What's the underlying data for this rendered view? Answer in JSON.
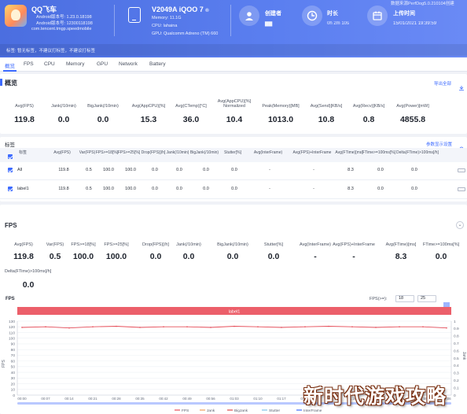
{
  "header": {
    "app": {
      "name": "QQ飞车",
      "lines": [
        "Android版本号: 1.23.0.18198",
        "Android版本号: 12300118198"
      ],
      "package": "com.tencent.tmgp.speedmobile"
    },
    "device": {
      "name": "V2049A iQOO 7",
      "badge": "®",
      "lines": [
        "Memory: 11.1G",
        "CPU: lahaina",
        "GPU: Qualcomm Adreno (TM) 660"
      ]
    },
    "creator": {
      "label": "创建者",
      "value": "▇▇"
    },
    "duration": {
      "label": "时长",
      "value": "0h 2m 10s"
    },
    "upload": {
      "label": "上传时间",
      "value": "15/01/2021 19:39:59",
      "top_text": "数据来源PerfDog5.0.210104创建"
    },
    "tags_text": "标签: 暂无标签，不建议打标签，不建议打标签"
  },
  "tabs": [
    "概览",
    "FPS",
    "CPU",
    "Memory",
    "GPU",
    "Network",
    "Battery"
  ],
  "overview": {
    "title": "概览",
    "export_link": "导出全部",
    "labels": [
      "Avg(FPS)",
      "Jank(/10min)",
      "BigJank(/10min)",
      "Avg(AppCPU)[%]",
      "Avg(CTemp)[°C]",
      "Avg(AppCPU)[%] Normalized",
      "Peak(Memory)[MB]",
      "Avg(Send)[KB/s]",
      "Avg(Recv)[KB/s]",
      "Avg(Power)[mW]"
    ],
    "values": [
      "119.8",
      "0.0",
      "0.0",
      "15.3",
      "36.0",
      "10.4",
      "1013.0",
      "10.8",
      "0.8",
      "4855.8"
    ]
  },
  "label_table": {
    "title": "标签",
    "right_link": "参数显示设置",
    "headers": [
      "标签",
      "Avg(FPS)",
      "Var(FPS)",
      "FPS>=18[%]",
      "FPS>=25[%]",
      "Drop(FPS)[/h]",
      "Jank(/10min)",
      "BigJank(/10min)",
      "Stutter[%]",
      "Avg(InterFrame)",
      "Avg(FPS)+InterFrame",
      "Avg(FTime)[ms]",
      "FTime>=100ms[%]",
      "Delta(FTime)>100ms[/h]"
    ],
    "rows": [
      {
        "name": "All",
        "values": [
          "119.8",
          "0.5",
          "100.0",
          "100.0",
          "0.0",
          "0.0",
          "0.0",
          "0.0",
          "-",
          "-",
          "8.3",
          "0.0",
          "0.0"
        ]
      },
      {
        "name": "label1",
        "values": [
          "119.8",
          "0.5",
          "100.0",
          "100.0",
          "0.0",
          "0.0",
          "0.0",
          "0.0",
          "-",
          "-",
          "8.3",
          "0.0",
          "0.0"
        ]
      }
    ]
  },
  "fps_section": {
    "title": "FPS",
    "labels": [
      "Avg(FPS)",
      "Var(FPS)",
      "FPS>=18[%]",
      "FPS>=25[%]",
      "Drop(FPS)[/h]",
      "Jank(/10min)",
      "BigJank(/10min)",
      "Stutter[%]",
      "Avg(InterFrame)",
      "Avg(FPS)+InterFrame",
      "Avg(FTime)[ms]",
      "FTime>=100ms[%]"
    ],
    "values": [
      "119.8",
      "0.5",
      "100.0",
      "100.0",
      "0.0",
      "0.0",
      "0.0",
      "0.0",
      "-",
      "-",
      "8.3",
      "0.0"
    ],
    "extra_label": "Delta(FTime)>100ms[/h]",
    "extra_value": "0.0"
  },
  "fps_chart": {
    "label": "FPS",
    "filter_label": "FPS(>=):",
    "filter_values": [
      "18",
      "25"
    ],
    "band_label": "label1",
    "y_axis_title": "FPS",
    "right_axis_title": "Jank",
    "watermark": "新时代游戏攻略"
  },
  "chart_data": {
    "type": "line",
    "x": [
      "00:00",
      "00:07",
      "00:14",
      "00:21",
      "00:28",
      "00:35",
      "00:42",
      "00:49",
      "00:56",
      "01:03",
      "01:10",
      "01:17",
      "01:24",
      "01:31",
      "01:38",
      "01:45",
      "01:52",
      "01:59",
      "02:06"
    ],
    "ylim": [
      0,
      130
    ],
    "yticks": [
      0,
      10,
      20,
      30,
      40,
      50,
      60,
      70,
      80,
      90,
      100,
      110,
      120,
      130
    ],
    "right_ylim": [
      0,
      1
    ],
    "right_ticks": [
      "1",
      "0.9",
      "0.8",
      "0.7",
      "0.6",
      "0.5",
      "0.4",
      "0.3",
      "0.2",
      "0.1",
      "0"
    ],
    "series": [
      {
        "name": "FPS",
        "color": "#e8505b",
        "values": [
          119,
          120,
          118,
          120,
          121,
          119,
          120,
          120,
          119,
          121,
          120,
          119,
          120,
          121,
          120,
          119,
          120,
          120,
          118
        ]
      },
      {
        "name": "Jank",
        "color": "#f0a05a",
        "values": []
      },
      {
        "name": "BigJank",
        "color": "#e04848",
        "values": []
      },
      {
        "name": "Stutter",
        "color": "#7fc3e8",
        "values": []
      },
      {
        "name": "InterFrame",
        "color": "#3d6bff",
        "values": []
      }
    ]
  }
}
